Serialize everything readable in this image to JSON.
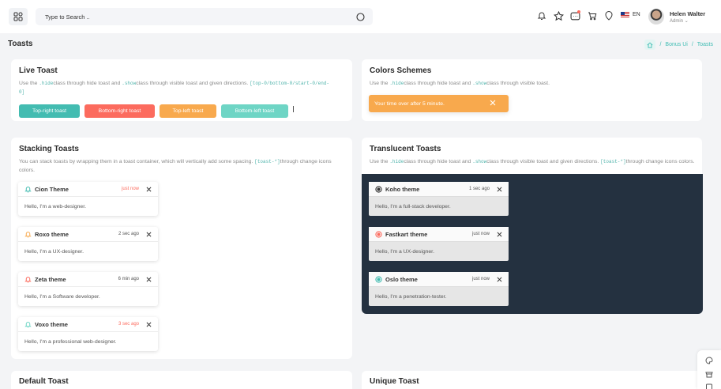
{
  "header": {
    "search_placeholder": "Type to Search ..",
    "language": "EN",
    "user_name": "Helen Walter",
    "user_role": "Admin"
  },
  "page": {
    "title": "Toasts",
    "breadcrumb": [
      "Bonus Ui",
      "Toasts"
    ]
  },
  "live": {
    "title": "Live Toast",
    "desc_parts": [
      "Use the ",
      ".hide",
      "class through hide toast and ",
      ".show",
      "class through visible toast and given directions. ",
      "[top-0/bottom-0/start-0/end-0]"
    ],
    "buttons": [
      "Top-right toast",
      "Bottom-right toast",
      "Top-left toast",
      "Bottom-left toast"
    ]
  },
  "colors": {
    "title": "Colors Schemes",
    "desc_parts": [
      "Use the ",
      ".hide",
      "class through hide toast and ",
      ".show",
      "class through visible toast."
    ],
    "toast_text": "Your time over after 5 minute."
  },
  "stacking": {
    "title": "Stacking Toasts",
    "desc_parts": [
      "You can stack toasts by wrapping them in a toast container, which will vertically add some spacing. ",
      "[toast-*]",
      "through change icons colors."
    ],
    "toasts": [
      {
        "name": "Cion Theme",
        "time": "just now",
        "body": "Hello, I'm a web-designer."
      },
      {
        "name": "Roxo theme",
        "time": "2 sec ago",
        "body": "Hello, I'm a UX-designer."
      },
      {
        "name": "Zeta theme",
        "time": "6 min ago",
        "body": "Hello, I'm a Software developer."
      },
      {
        "name": "Voxo theme",
        "time": "3 sec ago",
        "body": "Hello, I'm a professional web-designer."
      }
    ]
  },
  "translucent": {
    "title": "Translucent Toasts",
    "desc_parts": [
      "Use the ",
      ".hide",
      "class through hide toast and ",
      ".show",
      "class through visible toast and given directions. ",
      "[toast-*]",
      "through change icons colors."
    ],
    "toasts": [
      {
        "name": "Koho theme",
        "time": "1 sec ago",
        "body": "Hello, I'm a full-stack developer."
      },
      {
        "name": "Fastkart theme",
        "time": "just now",
        "body": "Hello, I'm a UX-designer."
      },
      {
        "name": "Oslo theme",
        "time": "just now",
        "body": "Hello, I'm a penetration-tester."
      }
    ]
  },
  "default_toast": {
    "title": "Default Toast"
  },
  "unique_toast": {
    "title": "Unique Toast"
  },
  "colors_map": {
    "primary": "#43bcb1",
    "danger": "#fc6b5e",
    "warning": "#f8a94d",
    "success": "#6ed5c5",
    "dark_panel": "#243140"
  }
}
